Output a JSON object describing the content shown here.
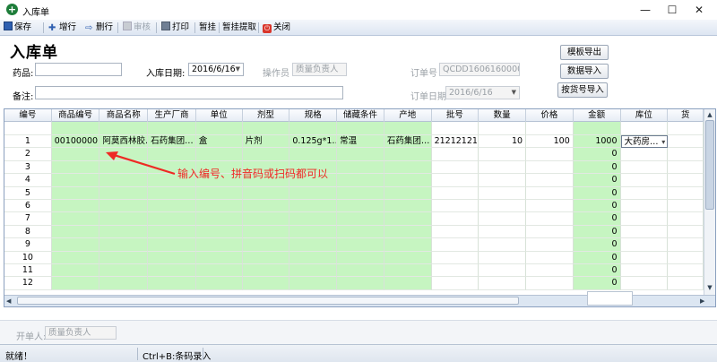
{
  "window": {
    "title": "入库单",
    "minimize_glyph": "—",
    "maximize_glyph": "☐",
    "close_glyph": "✕"
  },
  "toolbar": {
    "items": [
      {
        "label": "保存",
        "icon": "save-icon",
        "enabled": true
      },
      {
        "label": "增行",
        "icon": "add-row-icon",
        "enabled": true
      },
      {
        "label": "删行",
        "icon": "delete-row-icon",
        "enabled": true
      },
      {
        "label": "审核",
        "icon": "audit-icon",
        "enabled": false
      },
      {
        "label": "打印",
        "icon": "print-icon",
        "enabled": true
      },
      {
        "label": "暂挂",
        "icon": "",
        "enabled": true
      },
      {
        "label": "暂挂提取",
        "icon": "",
        "enabled": true
      },
      {
        "label": "关闭",
        "icon": "close-icon",
        "enabled": true
      }
    ]
  },
  "header": {
    "form_title": "入库单",
    "drug_label": "药品:",
    "drug_value": "",
    "date_label": "入库日期:",
    "date_value": "2016/6/16",
    "operator_label": "操作员",
    "operator_value": "质量负责人",
    "order_no_label": "订单号",
    "order_no_value": "QCDD16061600001",
    "order_date_label": "订单日期:",
    "order_date_value": "2016/6/16",
    "remark_label": "备注:",
    "remark_value": ""
  },
  "right_buttons": [
    "模板导出",
    "数据导入",
    "按货号导入"
  ],
  "grid": {
    "columns": [
      "编号",
      "商品编号",
      "商品名称",
      "生产厂商",
      "单位",
      "剂型",
      "规格",
      "储藏条件",
      "产地",
      "批号",
      "数量",
      "价格",
      "金额",
      "库位",
      "货"
    ],
    "rows": [
      [
        "1",
        "00100000",
        "阿莫西林胶…",
        "石药集团…",
        "盒",
        "片剂",
        "0.125g*1…",
        "常温",
        "石药集团…",
        "21212121",
        "10",
        "100",
        "1000",
        "大药房…"
      ],
      [
        "2",
        "",
        "",
        "",
        "",
        "",
        "",
        "",
        "",
        "",
        "",
        "",
        "0",
        ""
      ],
      [
        "3",
        "",
        "",
        "",
        "",
        "",
        "",
        "",
        "",
        "",
        "",
        "",
        "0",
        ""
      ],
      [
        "4",
        "",
        "",
        "",
        "",
        "",
        "",
        "",
        "",
        "",
        "",
        "",
        "0",
        ""
      ],
      [
        "5",
        "",
        "",
        "",
        "",
        "",
        "",
        "",
        "",
        "",
        "",
        "",
        "0",
        ""
      ],
      [
        "6",
        "",
        "",
        "",
        "",
        "",
        "",
        "",
        "",
        "",
        "",
        "",
        "0",
        ""
      ],
      [
        "7",
        "",
        "",
        "",
        "",
        "",
        "",
        "",
        "",
        "",
        "",
        "",
        "0",
        ""
      ],
      [
        "8",
        "",
        "",
        "",
        "",
        "",
        "",
        "",
        "",
        "",
        "",
        "",
        "0",
        ""
      ],
      [
        "9",
        "",
        "",
        "",
        "",
        "",
        "",
        "",
        "",
        "",
        "",
        "",
        "0",
        ""
      ],
      [
        "10",
        "",
        "",
        "",
        "",
        "",
        "",
        "",
        "",
        "",
        "",
        "",
        "0",
        ""
      ],
      [
        "11",
        "",
        "",
        "",
        "",
        "",
        "",
        "",
        "",
        "",
        "",
        "",
        "0",
        ""
      ],
      [
        "12",
        "",
        "",
        "",
        "",
        "",
        "",
        "",
        "",
        "",
        "",
        "",
        "0",
        ""
      ]
    ],
    "green_color": "#c6f5c1"
  },
  "annotation": {
    "text": "输入编号、拼音码或扫码都可以",
    "color": "#ee2a24"
  },
  "footer": {
    "creator_label": "开单人:",
    "creator_value": "质量负责人"
  },
  "status": {
    "ready": "就绪！",
    "shortcut": "Ctrl+B:条码录入"
  }
}
